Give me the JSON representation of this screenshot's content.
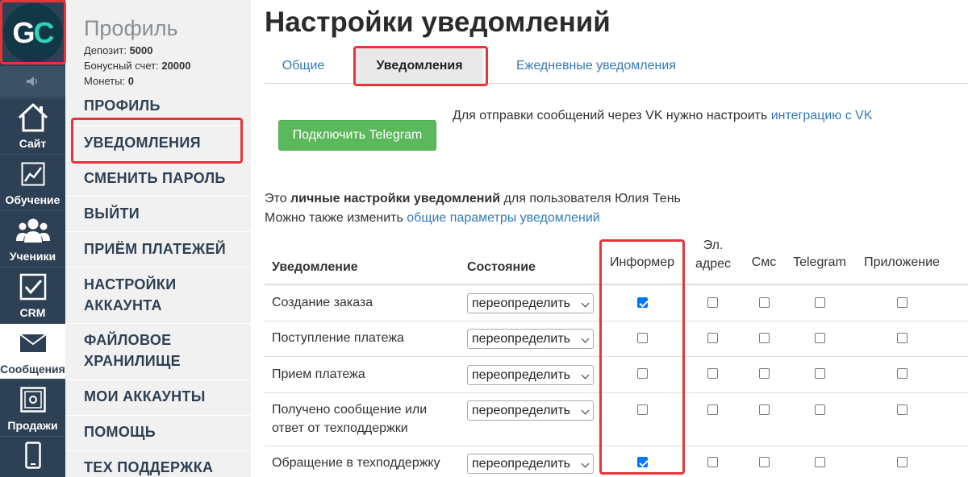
{
  "logo": {
    "letter_g": "G",
    "letter_c": "C"
  },
  "rail": {
    "items": [
      {
        "label": "Сайт",
        "icon": "home-icon"
      },
      {
        "label": "Обучение",
        "icon": "chart-icon"
      },
      {
        "label": "Ученики",
        "icon": "users-icon"
      },
      {
        "label": "CRM",
        "icon": "checkbox-icon"
      },
      {
        "label": "Сообщения",
        "icon": "envelope-icon"
      },
      {
        "label": "Продажи",
        "icon": "safe-icon"
      },
      {
        "label": "",
        "icon": "mobile-icon"
      }
    ]
  },
  "sidebar": {
    "title": "Профиль",
    "deposit_label": "Депозит:",
    "deposit_value": "5000",
    "bonus_label": "Бонусный счет:",
    "bonus_value": "20000",
    "coins_label": "Монеты:",
    "coins_value": "0",
    "menu": [
      "ПРОФИЛЬ",
      "УВЕДОМЛЕНИЯ",
      "СМЕНИТЬ ПАРОЛЬ",
      "ВЫЙТИ",
      "ПРИЁМ ПЛАТЕЖЕЙ",
      "НАСТРОЙКИ",
      "АККАУНТА",
      "ФАЙЛОВОЕ",
      "ХРАНИЛИЩЕ",
      "МОИ АККАУНТЫ",
      "ПОМОЩЬ",
      "ТЕХ ПОДДЕРЖКА"
    ]
  },
  "main": {
    "title": "Настройки уведомлений",
    "tabs": [
      {
        "label": "Общие",
        "active": false
      },
      {
        "label": "Уведомления",
        "active": true
      },
      {
        "label": "Ежедневные уведомления",
        "active": false
      }
    ],
    "telegram_button": "Подключить Telegram",
    "vk_note_text": "Для отправки сообщений через VK нужно настроить ",
    "vk_note_link": "интеграцию с VK",
    "info_line1_prefix": "Это ",
    "info_line1_bold": "личные настройки уведомлений",
    "info_line1_suffix": " для пользователя Юлия Тень",
    "info_line2_prefix": "Можно также изменить ",
    "info_line2_link": "общие параметры уведомлений"
  },
  "table": {
    "headers": {
      "notification": "Уведомление",
      "state": "Состояние",
      "informer": "Информер",
      "email_line1": "Эл.",
      "email_line2": "адрес",
      "sms": "Смс",
      "telegram": "Telegram",
      "app": "Приложение"
    },
    "rows": [
      {
        "name_line1": "Создание заказа",
        "name_line2": "",
        "state": "переопределить",
        "informer": true,
        "email": false,
        "sms": false,
        "telegram": false,
        "app": false
      },
      {
        "name_line1": "Поступление платежа",
        "name_line2": "",
        "state": "переопределить",
        "informer": false,
        "email": false,
        "sms": false,
        "telegram": false,
        "app": false
      },
      {
        "name_line1": "Прием платежа",
        "name_line2": "",
        "state": "переопределить",
        "informer": false,
        "email": false,
        "sms": false,
        "telegram": false,
        "app": false
      },
      {
        "name_line1": "Получено сообщение или",
        "name_line2": "ответ от техподдержки",
        "state": "переопределить",
        "informer": false,
        "email": false,
        "sms": false,
        "telegram": false,
        "app": false
      },
      {
        "name_line1": "Обращение в техподдержку",
        "name_line2": "",
        "state": "переопределить",
        "informer": true,
        "email": false,
        "sms": false,
        "telegram": false,
        "app": false
      }
    ]
  },
  "colors": {
    "rail_bg": "#2e4154",
    "sidebar_bg": "#f1f1f1",
    "link": "#337ab7",
    "button_green": "#5cb85c",
    "annotation_red": "#e5353a",
    "checkbox_checked": "#0075ff",
    "logo_accent": "#2fd1b5"
  }
}
